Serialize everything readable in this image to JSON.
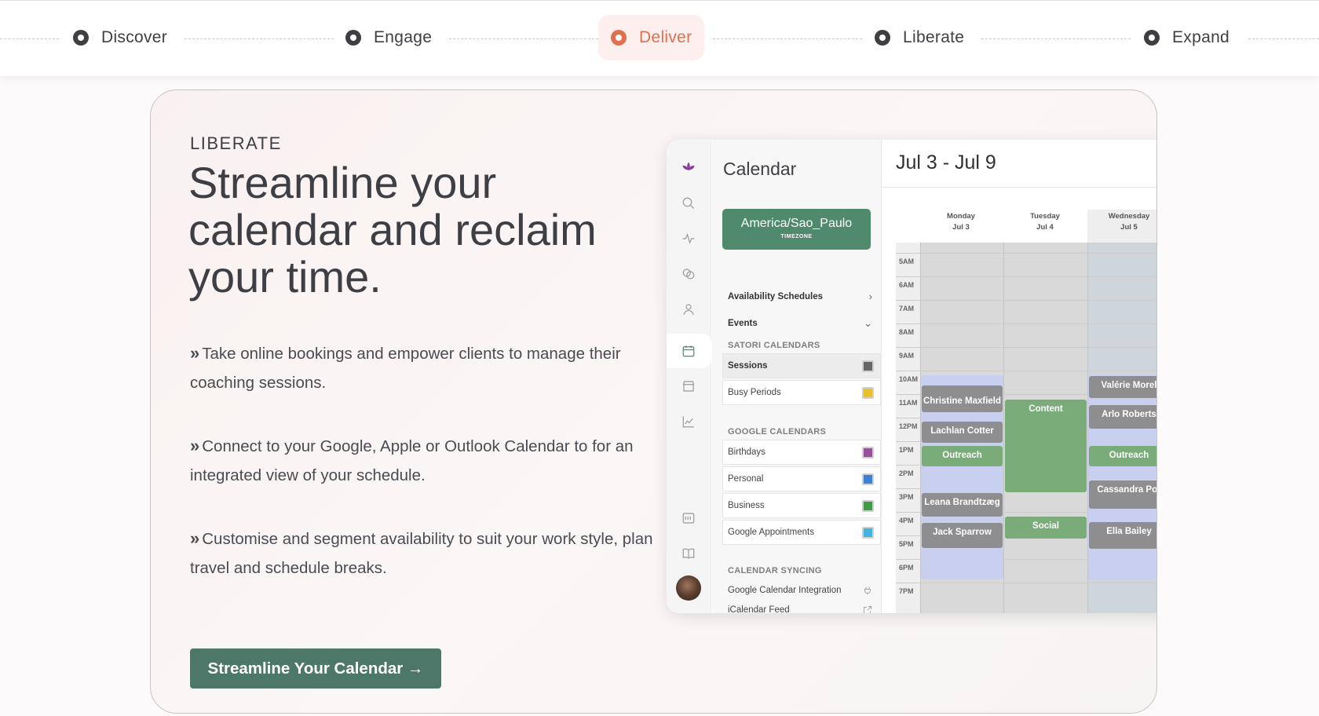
{
  "steps": [
    {
      "label": "Discover"
    },
    {
      "label": "Engage"
    },
    {
      "label": "Deliver",
      "active": true
    },
    {
      "label": "Liberate"
    },
    {
      "label": "Expand"
    }
  ],
  "hero": {
    "eyebrow": "LIBERATE",
    "headline": "Streamline your calendar and reclaim your time.",
    "bullets": [
      "Take online bookings and empower clients to manage their coaching sessions.",
      "Connect to your Google, Apple or Outlook Calendar to for an integrated view of your schedule.",
      "Customise and segment availability to suit your work style, plan travel and schedule breaks."
    ],
    "bullet_marker": "»",
    "cta_label": "Streamline Your Calendar →"
  },
  "app": {
    "sidebar_title": "Calendar",
    "timezone": {
      "name": "America/Sao_Paulo",
      "caption": "TIMEZONE"
    },
    "menu": {
      "availability": "Availability Schedules",
      "events": "Events"
    },
    "satori_section": "SATORI CALENDARS",
    "satori_calendars": [
      {
        "name": "Sessions",
        "color": "#666666",
        "selected": true
      },
      {
        "name": "Busy Periods",
        "color": "#e8c02c"
      }
    ],
    "google_section": "GOOGLE CALENDARS",
    "google_calendars": [
      {
        "name": "Birthdays",
        "color": "#9b4e9b"
      },
      {
        "name": "Personal",
        "color": "#3b82d6"
      },
      {
        "name": "Business",
        "color": "#3f9b47"
      },
      {
        "name": "Google Appointments",
        "color": "#44b3e0"
      }
    ],
    "sync_section": "CALENDAR SYNCING",
    "sync_items": [
      "Google Calendar Integration",
      "iCalendar Feed"
    ],
    "range": "Jul 3 - Jul 9",
    "days": [
      {
        "name": "Monday",
        "date": "Jul 3"
      },
      {
        "name": "Tuesday",
        "date": "Jul 4"
      },
      {
        "name": "Wednesday",
        "date": "Jul 5"
      }
    ],
    "hours": [
      "5AM",
      "6AM",
      "7AM",
      "8AM",
      "9AM",
      "10AM",
      "11AM",
      "12PM",
      "1PM",
      "2PM",
      "3PM",
      "4PM",
      "5PM",
      "6PM",
      "7PM"
    ],
    "events": [
      {
        "title": "Christine Maxfield",
        "day": 0,
        "color": "gray"
      },
      {
        "title": "Lachlan Cotter",
        "day": 0,
        "color": "gray"
      },
      {
        "title": "Outreach",
        "day": 0,
        "color": "green"
      },
      {
        "title": "Leana Brandtzæg",
        "day": 0,
        "color": "gray"
      },
      {
        "title": "Jack Sparrow",
        "day": 0,
        "color": "gray"
      },
      {
        "title": "Content",
        "day": 1,
        "color": "green"
      },
      {
        "title": "Social",
        "day": 1,
        "color": "green"
      },
      {
        "title": "Valérie Morel",
        "day": 2,
        "color": "gray"
      },
      {
        "title": "Arlo Roberts",
        "day": 2,
        "color": "gray"
      },
      {
        "title": "Outreach",
        "day": 2,
        "color": "green"
      },
      {
        "title": "Cassandra Por",
        "day": 2,
        "color": "gray"
      },
      {
        "title": "Ella Bailey",
        "day": 2,
        "color": "gray"
      }
    ]
  }
}
